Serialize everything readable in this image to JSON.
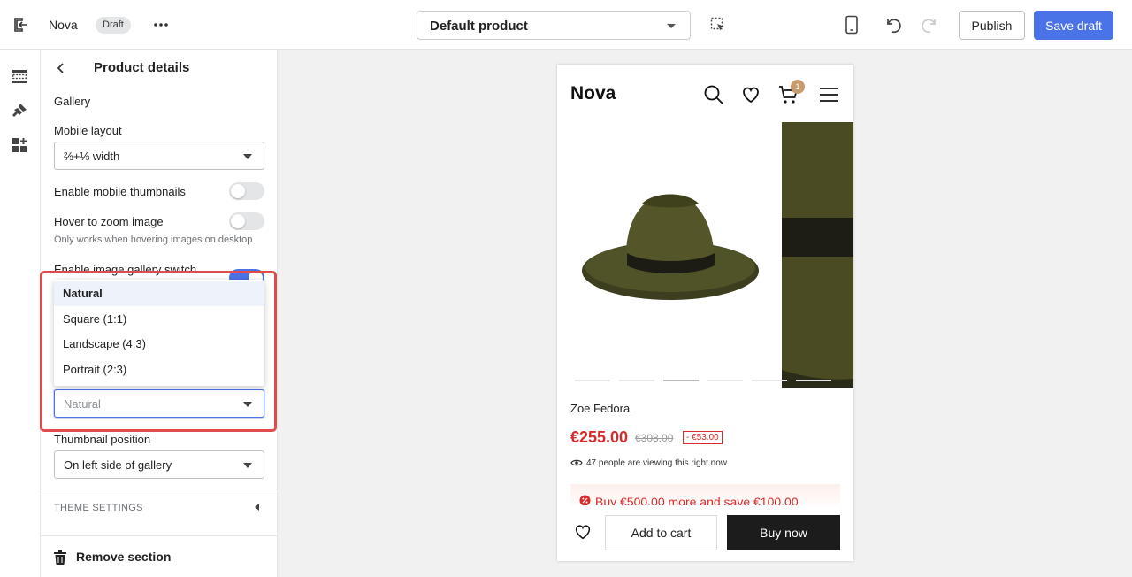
{
  "topbar": {
    "store_name": "Nova",
    "badge": "Draft",
    "template_select": "Default product",
    "publish_label": "Publish",
    "save_label": "Save draft"
  },
  "panel": {
    "title": "Product details",
    "gallery_heading": "Gallery",
    "mobile_layout_label": "Mobile layout",
    "mobile_layout_value": "⅔+⅓ width",
    "enable_mobile_thumbnails_label": "Enable mobile thumbnails",
    "enable_mobile_thumbnails_on": false,
    "hover_zoom_label": "Hover to zoom image",
    "hover_zoom_on": false,
    "hover_zoom_help": "Only works when hovering images on desktop",
    "gallery_switch_label": "Enable image gallery switch",
    "gallery_switch_on": true,
    "ratio_options": [
      "Natural",
      "Square (1:1)",
      "Landscape (4:3)",
      "Portrait (2:3)"
    ],
    "ratio_selected": "Natural",
    "thumbnail_position_label": "Thumbnail position",
    "thumbnail_position_value": "On left side of gallery",
    "theme_settings_label": "THEME SETTINGS",
    "remove_section_label": "Remove section"
  },
  "preview": {
    "logo": "Nova",
    "cart_count": "1",
    "product_name": "Zoe Fedora",
    "price": "€255.00",
    "old_price": "€308.00",
    "savings": "- €53.00",
    "viewing": "47 people are viewing this right now",
    "promo": "Buy €500.00 more and save €100.00",
    "add_to_cart": "Add to cart",
    "buy_now": "Buy now"
  },
  "colors": {
    "accent": "#4b73e8",
    "sale": "#d92b2b",
    "highlight": "#e14b4b"
  }
}
